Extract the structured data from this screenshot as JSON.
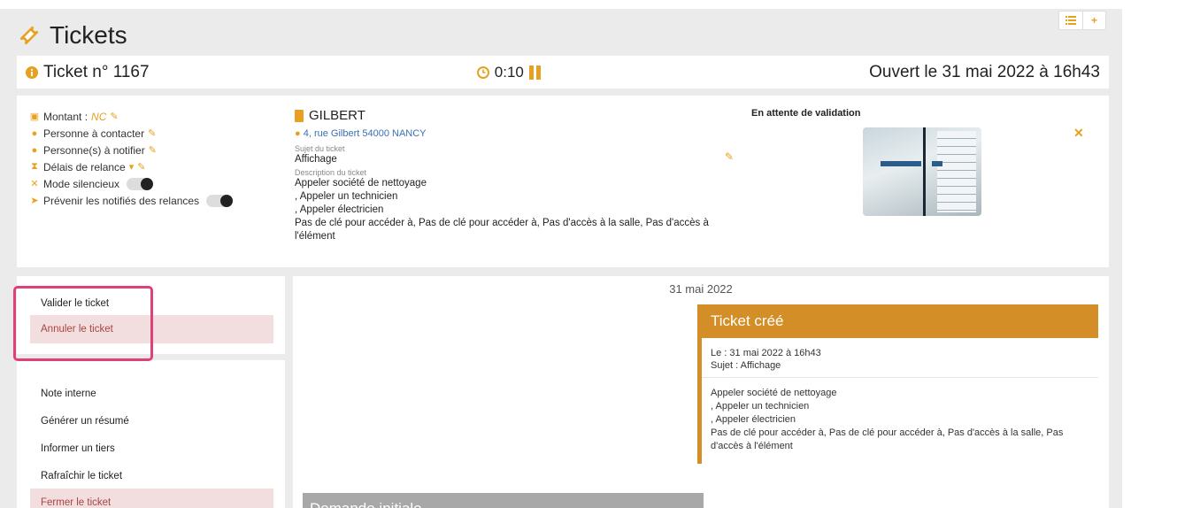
{
  "page": {
    "title": "Tickets"
  },
  "top_actions": {
    "list_icon": "list-icon",
    "add_icon": "plus-icon"
  },
  "header": {
    "ticket_label": "Ticket n° 1167",
    "timer": "0:10",
    "opened": "Ouvert le 31 mai 2022 à 16h43"
  },
  "details": {
    "montant_label": "Montant :",
    "montant_value": "NC",
    "contact_label": "Personne à contacter",
    "notify_label": "Personne(s) à notifier",
    "relance_label": "Délais de relance",
    "silent_label": "Mode silencieux",
    "warn_label": "Prévenir les notifiés des relances"
  },
  "customer": {
    "name": "GILBERT",
    "address": "4, rue Gilbert 54000 NANCY",
    "subject_label": "Sujet du ticket",
    "subject": "Affichage",
    "description_label": "Description du ticket",
    "description_lines": [
      "Appeler société de nettoyage",
      ", Appeler un technicien",
      ", Appeler électricien",
      "Pas de clé pour accéder à, Pas de clé pour accéder à, Pas d'accès à la salle, Pas d'accès à",
      "l'élément"
    ]
  },
  "status": {
    "label": "En attente de validation"
  },
  "actions_primary": [
    {
      "label": "Valider le ticket",
      "danger": false
    },
    {
      "label": "Annuler le ticket",
      "danger": true
    }
  ],
  "actions_secondary": [
    {
      "label": "Note interne",
      "danger": false
    },
    {
      "label": "Générer un résumé",
      "danger": false
    },
    {
      "label": "Informer un tiers",
      "danger": false
    },
    {
      "label": "Rafraîchir le ticket",
      "danger": false
    },
    {
      "label": "Fermer le ticket",
      "danger": true
    }
  ],
  "timeline": {
    "date": "31 mai 2022",
    "created_title": "Ticket créé",
    "created_date": "Le : 31 mai 2022 à 16h43",
    "created_subject": "Sujet : Affichage",
    "created_body_lines": [
      "Appeler société de nettoyage",
      ", Appeler un technicien",
      ", Appeler électricien",
      "Pas de clé pour accéder à, Pas de clé pour accéder à, Pas d'accès à la salle, Pas",
      "d'accès à l'élément"
    ],
    "initial_title": "Demande initiale"
  },
  "colors": {
    "accent": "#e8a020",
    "danger_bg": "#f2dede",
    "danger_text": "#a94442",
    "highlight": "#e0407a",
    "timeline_header": "#d48e27"
  }
}
